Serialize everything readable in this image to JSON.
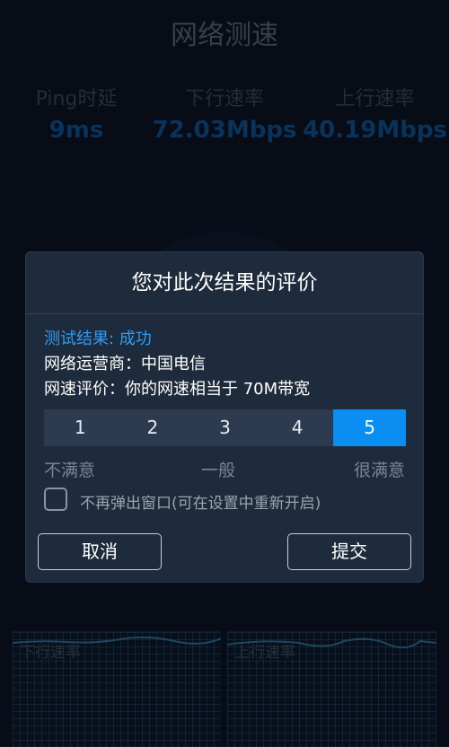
{
  "page": {
    "title": "网络测速"
  },
  "stats": {
    "ping": {
      "label": "Ping时延",
      "value": "9ms"
    },
    "download": {
      "label": "下行速率",
      "value": "72.03Mbps"
    },
    "upload": {
      "label": "上行速率",
      "value": "40.19Mbps"
    }
  },
  "charts": {
    "download_label": "下行速率",
    "upload_label": "上行速率"
  },
  "dialog": {
    "title": "您对此次结果的评价",
    "result": "测试结果: 成功",
    "isp": "网络运营商：中国电信",
    "speed_rating": "网速评价：你的网速相当于 70M带宽",
    "ratings": [
      "1",
      "2",
      "3",
      "4",
      "5"
    ],
    "selected_rating": "5",
    "scale": {
      "low": "不满意",
      "mid": "一般",
      "high": "很满意"
    },
    "checkbox_label": "不再弹出窗口(可在设置中重新开启)",
    "checkbox_checked": false,
    "cancel_label": "取消",
    "submit_label": "提交"
  },
  "colors": {
    "background": "#0b1322",
    "dialog": "#1e2b3d",
    "accent": "#0a8ef2",
    "result_text": "#2f9cf3"
  }
}
